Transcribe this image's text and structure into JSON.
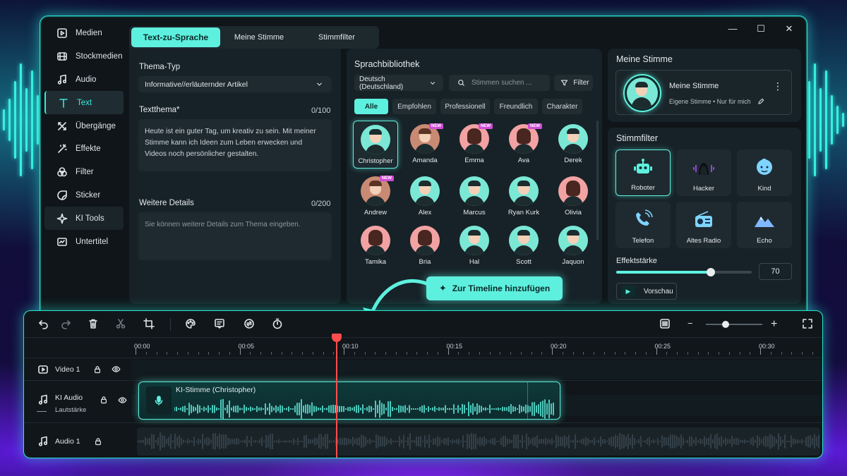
{
  "window_controls": {
    "minimize": "—",
    "maximize": "☐",
    "close": "✕"
  },
  "sidebar": {
    "items": [
      {
        "label": "Medien",
        "icon": "media-icon"
      },
      {
        "label": "Stockmedien",
        "icon": "stock-media-icon"
      },
      {
        "label": "Audio",
        "icon": "music-note-icon"
      },
      {
        "label": "Text",
        "icon": "text-icon"
      },
      {
        "label": "Übergänge",
        "icon": "transitions-icon"
      },
      {
        "label": "Effekte",
        "icon": "effects-icon"
      },
      {
        "label": "Filter",
        "icon": "filter-icon"
      },
      {
        "label": "Sticker",
        "icon": "sticker-icon"
      },
      {
        "label": "KI Tools",
        "icon": "ai-sparkle-icon"
      },
      {
        "label": "Untertitel",
        "icon": "subtitles-icon"
      }
    ]
  },
  "tabs": [
    "Text-zu-Sprache",
    "Meine Stimme",
    "Stimmfilter"
  ],
  "tts": {
    "theme_type_label": "Thema-Typ",
    "theme_type_value": "Informative//erläuternder Artikel",
    "text_topic_label": "Textthema*",
    "text_topic_count": "0/100",
    "text_topic_value": "Heute ist ein guter Tag, um kreativ zu sein. Mit meiner Stimme kann ich Ideen zum Leben erwecken und Videos noch persönlicher gestalten.",
    "details_label": "Weitere Details",
    "details_count": "0/200",
    "details_placeholder": "Sie können weitere Details zum Thema eingeben."
  },
  "library": {
    "title": "Sprachbibliothek",
    "language": "Deutsch (Deutschland)",
    "search_placeholder": "Stimmen suchen ...",
    "filter_label": "Filter",
    "chips": [
      "Alle",
      "Empfohlen",
      "Professionell",
      "Freundlich",
      "Charakter"
    ],
    "new_badge": "NEW",
    "voices": [
      {
        "name": "Christopher",
        "style": "teal",
        "selected": true,
        "new": false
      },
      {
        "name": "Amanda",
        "style": "photo",
        "new": true
      },
      {
        "name": "Emma",
        "style": "pink",
        "new": true
      },
      {
        "name": "Ava",
        "style": "pink",
        "new": true
      },
      {
        "name": "Derek",
        "style": "teal",
        "new": false
      },
      {
        "name": "Andrew",
        "style": "photo",
        "new": true
      },
      {
        "name": "Alex",
        "style": "teal",
        "new": false
      },
      {
        "name": "Marcus",
        "style": "teal",
        "new": false
      },
      {
        "name": "Ryan Kurk",
        "style": "teal",
        "new": false
      },
      {
        "name": "Olivia",
        "style": "pink",
        "new": false
      },
      {
        "name": "Tamika",
        "style": "pink",
        "new": false
      },
      {
        "name": "Bria",
        "style": "pink",
        "new": false
      },
      {
        "name": "Hal",
        "style": "teal",
        "new": false
      },
      {
        "name": "Scott",
        "style": "teal",
        "new": false
      },
      {
        "name": "Jaquon",
        "style": "teal",
        "new": false
      }
    ]
  },
  "add_to_timeline": "Zur Timeline hinzufügen",
  "my_voice": {
    "section_title": "Meine Stimme",
    "card_title": "Meine Stimme",
    "card_subtitle": "Eigene Stimme • Nur für mich",
    "more": "⋮"
  },
  "voice_filters": {
    "title": "Stimmfilter",
    "items": [
      {
        "label": "Roboter",
        "icon": "robot-icon",
        "selected": true
      },
      {
        "label": "Hacker",
        "icon": "hacker-icon"
      },
      {
        "label": "Kind",
        "icon": "child-face-icon"
      },
      {
        "label": "Telefon",
        "icon": "phone-icon"
      },
      {
        "label": "Altes Radio",
        "icon": "radio-icon"
      },
      {
        "label": "Echo",
        "icon": "mountain-echo-icon"
      }
    ],
    "strength_label": "Effektstärke",
    "strength_value": "70",
    "strength_level": 0.7,
    "preview_label": "Vorschau"
  },
  "timeline": {
    "ruler_labels": [
      "00:00",
      "00:05",
      "00:10",
      "00:15",
      "00:20",
      "00:25",
      "00:30"
    ],
    "tracks": [
      {
        "name": "Video 1"
      },
      {
        "name": "KI Audio",
        "sub": "Lautstärke"
      },
      {
        "name": "Audio 1"
      }
    ],
    "clip_label": "KI-Stimme (Christopher)",
    "playhead_time": "00:10",
    "zoom_level": 0.35
  },
  "colors": {
    "accent": "#5ef0de",
    "playhead": "#ff4d4d",
    "badge": "#d04cd6"
  }
}
